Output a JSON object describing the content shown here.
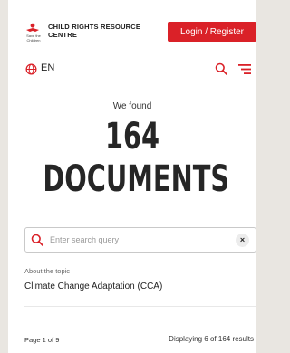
{
  "header": {
    "logo_small_text": "Save the Children",
    "logo_title_line1": "CHILD RIGHTS RESOURCE",
    "logo_title_line2": "CENTRE",
    "login_label": "Login / Register"
  },
  "toolbar": {
    "language": "EN"
  },
  "results": {
    "found_text": "We found",
    "count": "164",
    "documents_label": "DOCUMENTS"
  },
  "search": {
    "placeholder": "Enter search query",
    "value": "",
    "clear_symbol": "×"
  },
  "topic": {
    "label": "About the topic",
    "value": "Climate Change Adaptation (CCA)"
  },
  "pagination": {
    "page_text": "Page 1 of 9",
    "displaying_text": "Displaying 6 of 164 results"
  },
  "colors": {
    "accent": "#da2128",
    "background": "#ffffff",
    "page_background": "#e9e6e1"
  },
  "icons": {
    "logo": "save-the-children-logo-icon",
    "language": "globe-icon",
    "search_top": "search-icon",
    "menu": "menu-icon",
    "search_field": "search-icon",
    "clear": "close-icon"
  }
}
